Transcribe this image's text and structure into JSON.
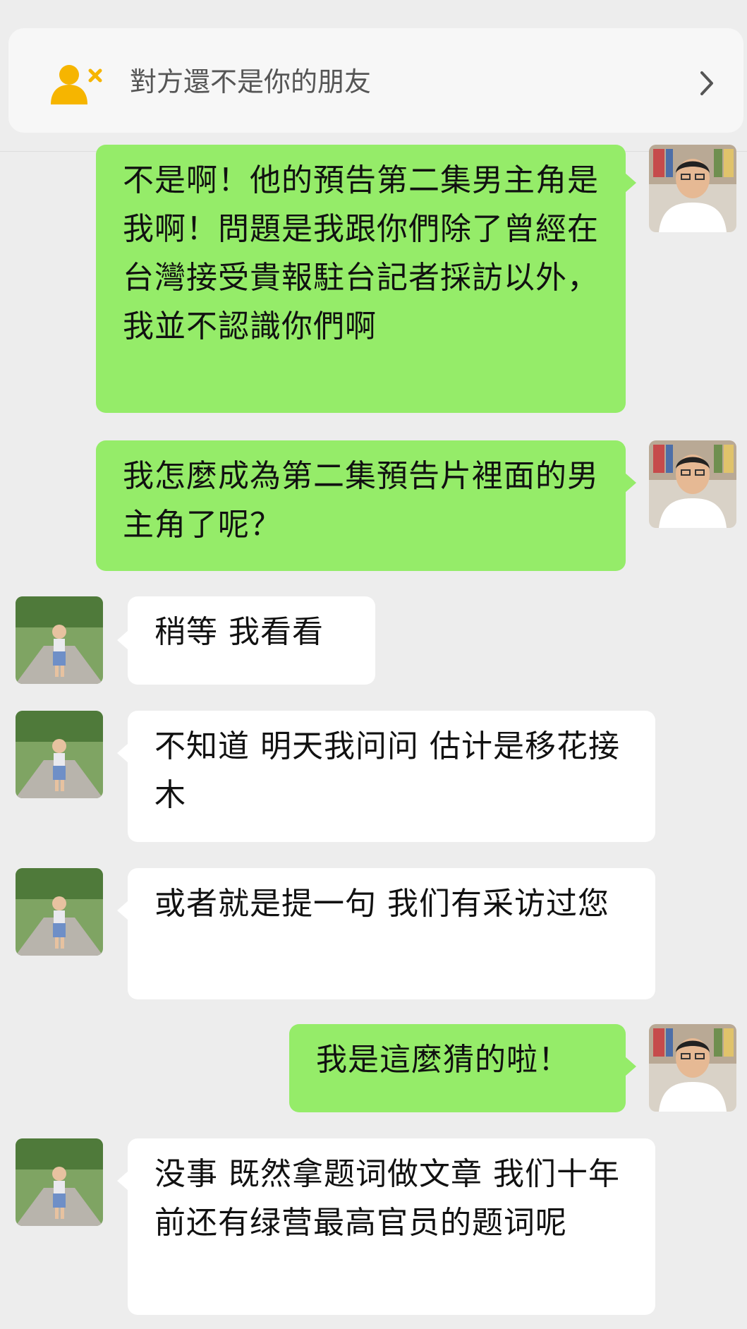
{
  "notice": {
    "text": "對方還不是你的朋友",
    "icon": "add-friend-icon",
    "chevron": "chevron-right-icon"
  },
  "messages": [
    {
      "from": "me",
      "text": "不是啊！他的預告第二集男主角是我啊！問題是我跟你們除了曾經在台灣接受貴報駐台記者採訪以外，我並不認識你們啊"
    },
    {
      "from": "me",
      "text": "我怎麼成為第二集預告片裡面的男主角了呢？"
    },
    {
      "from": "them",
      "text": "稍等 我看看"
    },
    {
      "from": "them",
      "text": "不知道  明天我问问 估计是移花接木"
    },
    {
      "from": "them",
      "text": "或者就是提一句 我们有采访过您"
    },
    {
      "from": "me",
      "text": "我是這麼猜的啦！"
    },
    {
      "from": "them",
      "text": "没事 既然拿题词做文章 我们十年前还有绿营最高官员的题词呢"
    }
  ],
  "colors": {
    "background": "#ededed",
    "my_bubble": "#95ec69",
    "their_bubble": "#ffffff",
    "notice_icon": "#f6b500"
  }
}
